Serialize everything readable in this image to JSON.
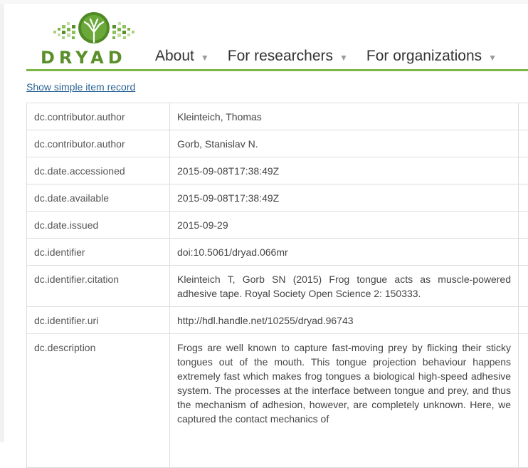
{
  "site": {
    "logo_text": "DRYAD",
    "accent_color": "#7ab648",
    "logo_color": "#5a8f2a"
  },
  "nav": {
    "items": [
      {
        "label": "About",
        "icon": "chevron-down-icon"
      },
      {
        "label": "For researchers",
        "icon": "chevron-down-icon"
      },
      {
        "label": "For organizations",
        "icon": "chevron-down-icon"
      }
    ]
  },
  "record": {
    "simple_link": "Show simple item record",
    "rows": [
      {
        "key": "dc.contributor.author",
        "value": "Kleinteich, Thomas"
      },
      {
        "key": "dc.contributor.author",
        "value": "Gorb, Stanislav N."
      },
      {
        "key": "dc.date.accessioned",
        "value": "2015-09-08T17:38:49Z"
      },
      {
        "key": "dc.date.available",
        "value": "2015-09-08T17:38:49Z"
      },
      {
        "key": "dc.date.issued",
        "value": "2015-09-29"
      },
      {
        "key": "dc.identifier",
        "value": "doi:10.5061/dryad.066mr"
      },
      {
        "key": "dc.identifier.citation",
        "value": "Kleinteich T, Gorb SN (2015) Frog tongue acts as muscle-powered adhesive tape. Royal Society Open Science 2: 150333."
      },
      {
        "key": "dc.identifier.uri",
        "value": "http://hdl.handle.net/10255/dryad.96743"
      },
      {
        "key": "dc.description",
        "value": "Frogs are well known to capture fast-moving prey by flicking their sticky tongues out of the mouth. This tongue projection behaviour happens extremely fast which makes frog tongues a biological high-speed adhesive system. The processes at the interface between tongue and prey, and thus the mechanism of adhesion, however, are completely unknown. Here, we captured the contact mechanics of"
      }
    ]
  }
}
